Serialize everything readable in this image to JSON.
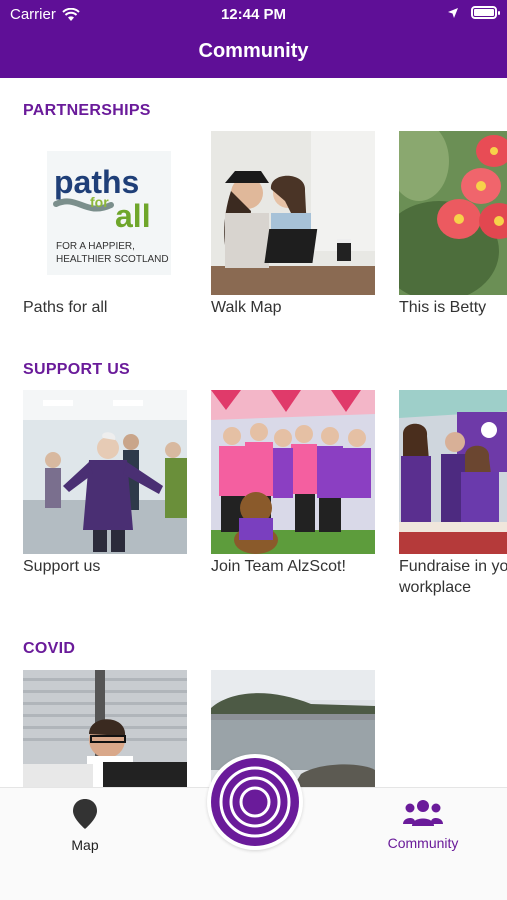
{
  "status_bar": {
    "carrier": "Carrier",
    "time": "12:44 PM"
  },
  "header": {
    "title": "Community"
  },
  "sections": [
    {
      "title": "PARTNERSHIPS",
      "cards": [
        {
          "caption": "Paths for all",
          "logo": {
            "line1": "paths",
            "line2": "for",
            "line3": "all",
            "tagline1": "FOR A HAPPIER,",
            "tagline2": "HEALTHIER SCOTLAND"
          }
        },
        {
          "caption": "Walk Map"
        },
        {
          "caption": "This is Betty"
        }
      ]
    },
    {
      "title": "SUPPORT US",
      "cards": [
        {
          "caption": "Support us"
        },
        {
          "caption": "Join Team AlzScot!"
        },
        {
          "caption": "Fundraise in your workplace"
        }
      ]
    },
    {
      "title": "COVID",
      "cards": [
        {
          "caption": ""
        },
        {
          "caption": ""
        }
      ]
    }
  ],
  "tabbar": {
    "map_label": "Map",
    "community_label": "Community"
  },
  "colors": {
    "brand_purple": "#5f0f97",
    "accent_purple": "#6a1b9a"
  },
  "icons": [
    "wifi-icon",
    "location-arrow-icon",
    "battery-icon",
    "map-pin-icon",
    "community-icon",
    "home-rings-icon"
  ]
}
